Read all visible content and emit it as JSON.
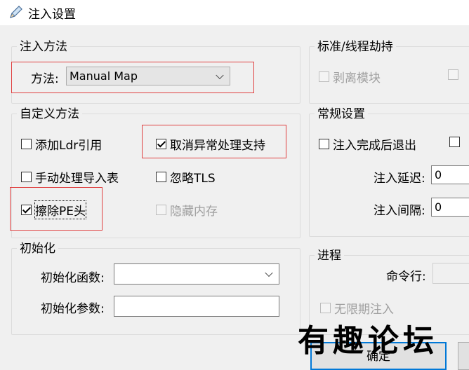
{
  "window": {
    "title": "注入设置",
    "icon": "pencil-icon"
  },
  "inject_method": {
    "legend": "注入方法",
    "method_label": "方法:",
    "method_value": "Manual Map"
  },
  "standard_thread_hijack": {
    "legend": "标准/线程劫持",
    "strip_module": {
      "label": "剥离模块",
      "checked": false,
      "enabled": false
    }
  },
  "custom_method": {
    "legend": "自定义方法",
    "add_ldr_ref": {
      "label": "添加Ldr引用",
      "checked": false
    },
    "cancel_exception": {
      "label": "取消异常处理支持",
      "checked": true
    },
    "manual_import": {
      "label": "手动处理导入表",
      "checked": false
    },
    "ignore_tls": {
      "label": "忽略TLS",
      "checked": false
    },
    "erase_pe": {
      "label": "擦除PE头",
      "checked": true
    },
    "hide_memory": {
      "label": "隐藏内存",
      "checked": false,
      "enabled": false
    }
  },
  "general": {
    "legend": "常规设置",
    "exit_after_inject": {
      "label": "注入完成后退出",
      "checked": false
    },
    "delay_label": "注入延迟:",
    "delay_value": "0",
    "interval_label": "注入间隔:",
    "interval_value": "0"
  },
  "init": {
    "legend": "初始化",
    "func_label": "初始化函数:",
    "func_value": "",
    "args_label": "初始化参数:",
    "args_value": ""
  },
  "process": {
    "legend": "进程",
    "cmdline_label": "命令行:",
    "cmdline_value": "",
    "infinite_inject": {
      "label": "无限期注入",
      "checked": false,
      "enabled": false
    }
  },
  "buttons": {
    "ok": "确定"
  },
  "watermark": "有趣论坛",
  "colors": {
    "accent": "#0078d7",
    "highlight": "#e04040",
    "background": "#f0f0f0"
  }
}
